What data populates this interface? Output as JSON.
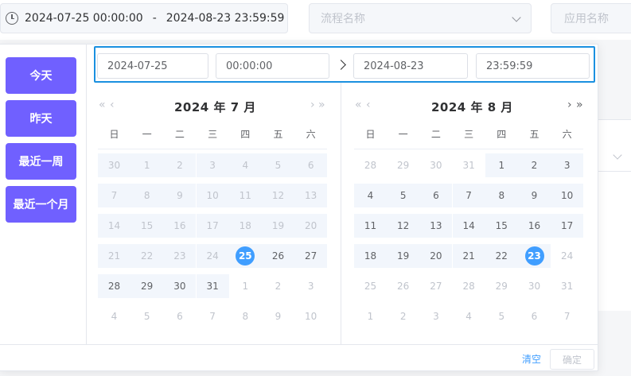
{
  "filters": {
    "range_start": "2024-07-25 00:00:00",
    "range_sep": "-",
    "range_end": "2024-08-23 23:59:59",
    "process_name_placeholder": "流程名称",
    "app_name_placeholder": "应用名称"
  },
  "shortcuts": [
    "今天",
    "昨天",
    "最近一周",
    "最近一个月"
  ],
  "time_header": {
    "start_date": "2024-07-25",
    "start_time": "00:00:00",
    "end_date": "2024-08-23",
    "end_time": "23:59:59"
  },
  "nav_icons": {
    "prev_year": "«",
    "prev_month": "‹",
    "next_month": "›",
    "next_year": "»"
  },
  "weekdays": [
    "日",
    "一",
    "二",
    "三",
    "四",
    "五",
    "六"
  ],
  "left_calendar": {
    "title": "2024 年 7 月",
    "days": [
      [
        "30",
        "other"
      ],
      [
        "1",
        "other"
      ],
      [
        "2",
        "other"
      ],
      [
        "3",
        "other"
      ],
      [
        "4",
        "other"
      ],
      [
        "5",
        "other"
      ],
      [
        "6",
        "other"
      ],
      [
        "7",
        "other"
      ],
      [
        "8",
        "other"
      ],
      [
        "9",
        "other"
      ],
      [
        "10",
        "other"
      ],
      [
        "11",
        "other"
      ],
      [
        "12",
        "other"
      ],
      [
        "13",
        "other"
      ],
      [
        "14",
        "other"
      ],
      [
        "15",
        "other"
      ],
      [
        "16",
        "other"
      ],
      [
        "17",
        "other"
      ],
      [
        "18",
        "other"
      ],
      [
        "19",
        "other"
      ],
      [
        "20",
        "other"
      ],
      [
        "21",
        "other"
      ],
      [
        "22",
        "other"
      ],
      [
        "23",
        "other"
      ],
      [
        "24",
        "other"
      ],
      [
        "25",
        "selected"
      ],
      [
        "26",
        "cur"
      ],
      [
        "27",
        "cur"
      ],
      [
        "28",
        "cur"
      ],
      [
        "29",
        "cur"
      ],
      [
        "30",
        "cur"
      ],
      [
        "31",
        "cur"
      ],
      [
        "1",
        "next"
      ],
      [
        "2",
        "next"
      ],
      [
        "3",
        "next"
      ],
      [
        "4",
        "next"
      ],
      [
        "5",
        "next"
      ],
      [
        "6",
        "next"
      ],
      [
        "7",
        "next"
      ],
      [
        "8",
        "next"
      ],
      [
        "9",
        "next"
      ],
      [
        "10",
        "next"
      ]
    ]
  },
  "right_calendar": {
    "title": "2024 年 8 月",
    "days": [
      [
        "28",
        "prev"
      ],
      [
        "29",
        "prev"
      ],
      [
        "30",
        "prev"
      ],
      [
        "31",
        "prev"
      ],
      [
        "1",
        "cur"
      ],
      [
        "2",
        "cur"
      ],
      [
        "3",
        "cur"
      ],
      [
        "4",
        "cur"
      ],
      [
        "5",
        "cur"
      ],
      [
        "6",
        "cur"
      ],
      [
        "7",
        "cur"
      ],
      [
        "8",
        "cur"
      ],
      [
        "9",
        "cur"
      ],
      [
        "10",
        "cur"
      ],
      [
        "11",
        "cur"
      ],
      [
        "12",
        "cur"
      ],
      [
        "13",
        "cur"
      ],
      [
        "14",
        "cur"
      ],
      [
        "15",
        "cur"
      ],
      [
        "16",
        "cur"
      ],
      [
        "17",
        "cur"
      ],
      [
        "18",
        "cur"
      ],
      [
        "19",
        "cur"
      ],
      [
        "20",
        "cur"
      ],
      [
        "21",
        "cur"
      ],
      [
        "22",
        "cur"
      ],
      [
        "23",
        "selected"
      ],
      [
        "24",
        "other"
      ],
      [
        "25",
        "other"
      ],
      [
        "26",
        "other"
      ],
      [
        "27",
        "other"
      ],
      [
        "28",
        "other"
      ],
      [
        "29",
        "other"
      ],
      [
        "30",
        "other"
      ],
      [
        "31",
        "other"
      ],
      [
        "1",
        "other"
      ],
      [
        "2",
        "other"
      ],
      [
        "3",
        "other"
      ],
      [
        "4",
        "other"
      ],
      [
        "5",
        "other"
      ],
      [
        "6",
        "other"
      ],
      [
        "7",
        "other"
      ]
    ]
  },
  "footer": {
    "clear": "清空",
    "confirm": "确定"
  },
  "colors": {
    "accent": "#409eff",
    "shortcut_bg": "#7060ff",
    "focus_border": "#1a90e0",
    "range_bg": "#f2f6fc"
  }
}
